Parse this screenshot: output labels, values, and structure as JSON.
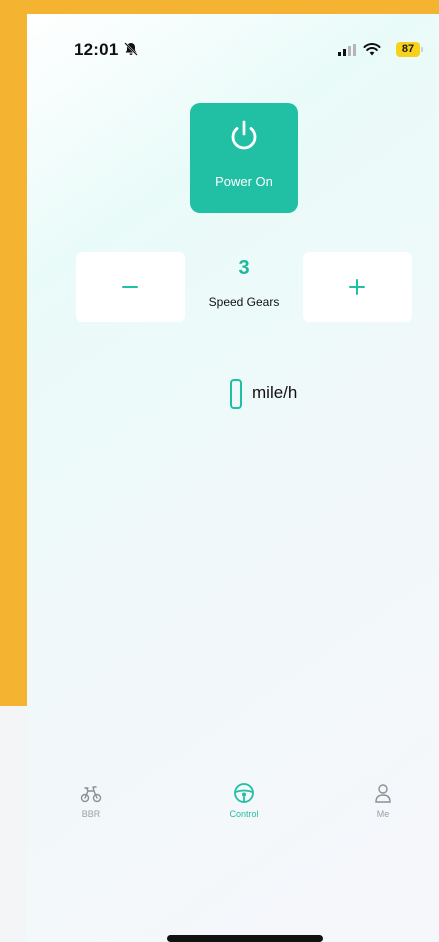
{
  "status_bar": {
    "time": "12:01",
    "battery": "87"
  },
  "power": {
    "label": "Power On"
  },
  "speed_gears": {
    "minus_label": "−",
    "plus_label": "+",
    "value": "3",
    "label": "Speed Gears"
  },
  "speed": {
    "unit": "mile/h"
  },
  "tabbar": {
    "items": [
      {
        "label": "BBR",
        "icon": "bicycle-icon"
      },
      {
        "label": "Control",
        "icon": "steering-wheel-icon",
        "active": true
      },
      {
        "label": "Me",
        "icon": "person-icon"
      }
    ]
  },
  "colors": {
    "accent": "#21c0a4",
    "background_outer": "#f4b331"
  }
}
